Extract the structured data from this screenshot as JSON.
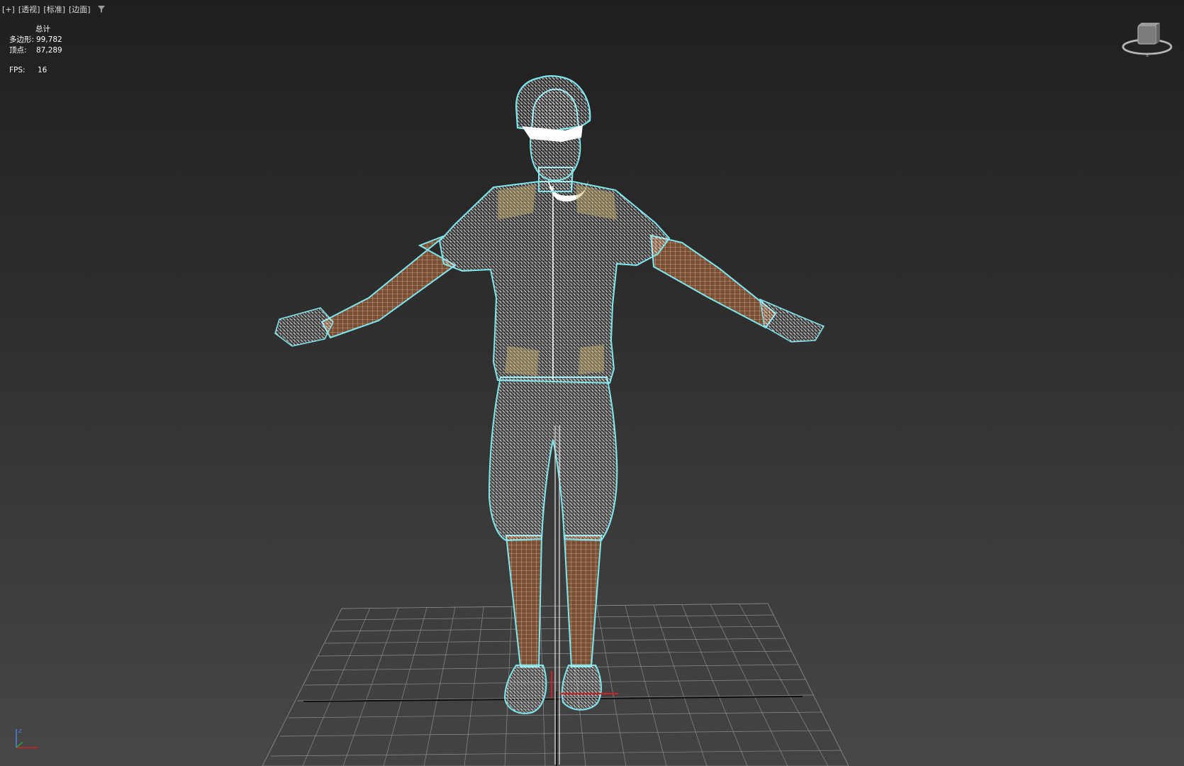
{
  "viewport": {
    "labels": [
      "[+]",
      "[透视]",
      "[标准]",
      "[边面]"
    ],
    "filter_icon": "funnel-filter-icon"
  },
  "stats": {
    "header": "总计",
    "polygons_label": "多边形:",
    "polygons_value": "99,782",
    "vertices_label": "顶点:",
    "vertices_value": "87,289",
    "fps_label": "FPS:",
    "fps_value": "16"
  },
  "viewcube": {
    "icon": "viewcube-navigation-icon"
  },
  "axis_tripod": {
    "icon": "xyz-axis-icon",
    "axis_label": "z"
  },
  "scene": {
    "model": "cyclist-wireframe-tpose",
    "colors": {
      "selection_outline": "#7fe8ef",
      "wire": "#ffffff",
      "skin": "#7a4e33",
      "jersey_accent": "#c9b26c",
      "grid": "#8c8c8c",
      "axis_x": "#d02020"
    }
  }
}
